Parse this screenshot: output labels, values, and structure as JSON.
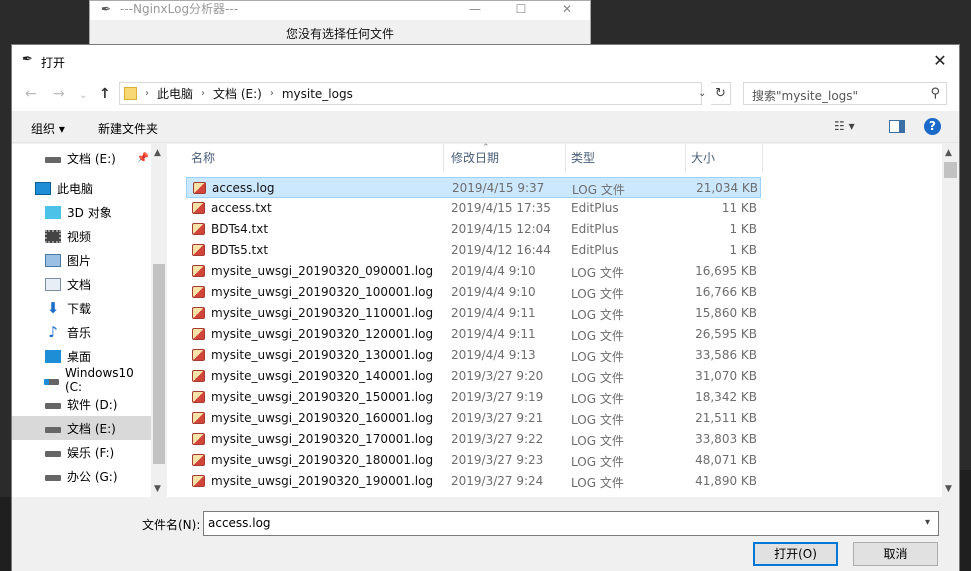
{
  "parent_window": {
    "title": "---NginxLog分析器---",
    "status": "您没有选择任何文件",
    "controls": [
      "—",
      "☐",
      "✕"
    ]
  },
  "dialog": {
    "title": "打开",
    "close": "✕"
  },
  "nav": {
    "back": "←",
    "forward": "→",
    "recent": "⌄",
    "up": "↑",
    "breadcrumb": [
      "此电脑",
      "文档 (E:)",
      "mysite_logs"
    ],
    "sep": "›",
    "dropdown": "⌄",
    "refresh": "↻",
    "search_placeholder": "搜索\"mysite_logs\"",
    "search_icon": "⚲"
  },
  "toolbar": {
    "organize": "组织 ▾",
    "new_folder": "新建文件夹",
    "view": "☷ ▾",
    "help": "?"
  },
  "sidebar": {
    "items": [
      {
        "label": "文档 (E:)",
        "icon": "drive-icon",
        "pinned": true
      },
      {
        "label": "此电脑",
        "icon": "computer-icon"
      },
      {
        "label": "3D 对象",
        "icon": "cube-icon"
      },
      {
        "label": "视频",
        "icon": "video-icon"
      },
      {
        "label": "图片",
        "icon": "picture-icon"
      },
      {
        "label": "文档",
        "icon": "document-icon"
      },
      {
        "label": "下载",
        "icon": "download-icon"
      },
      {
        "label": "音乐",
        "icon": "music-icon"
      },
      {
        "label": "桌面",
        "icon": "desktop-icon"
      },
      {
        "label": "Windows10 (C:",
        "icon": "os-drive-icon"
      },
      {
        "label": "软件 (D:)",
        "icon": "drive-icon"
      },
      {
        "label": "文档 (E:)",
        "icon": "drive-icon",
        "selected": true
      },
      {
        "label": "娱乐 (F:)",
        "icon": "drive-icon"
      },
      {
        "label": "办公 (G:)",
        "icon": "drive-icon"
      }
    ]
  },
  "columns": {
    "name": "名称",
    "date": "修改日期",
    "type": "类型",
    "size": "大小"
  },
  "files": [
    {
      "name": "access.log",
      "date": "2019/4/15 9:37",
      "type": "LOG 文件",
      "size": "21,034 KB",
      "selected": true
    },
    {
      "name": "access.txt",
      "date": "2019/4/15 17:35",
      "type": "EditPlus",
      "size": "11 KB"
    },
    {
      "name": "BDTs4.txt",
      "date": "2019/4/15 12:04",
      "type": "EditPlus",
      "size": "1 KB"
    },
    {
      "name": "BDTs5.txt",
      "date": "2019/4/12 16:44",
      "type": "EditPlus",
      "size": "1 KB"
    },
    {
      "name": "mysite_uwsgi_20190320_090001.log",
      "date": "2019/4/4 9:10",
      "type": "LOG 文件",
      "size": "16,695 KB"
    },
    {
      "name": "mysite_uwsgi_20190320_100001.log",
      "date": "2019/4/4 9:10",
      "type": "LOG 文件",
      "size": "16,766 KB"
    },
    {
      "name": "mysite_uwsgi_20190320_110001.log",
      "date": "2019/4/4 9:11",
      "type": "LOG 文件",
      "size": "15,860 KB"
    },
    {
      "name": "mysite_uwsgi_20190320_120001.log",
      "date": "2019/4/4 9:11",
      "type": "LOG 文件",
      "size": "26,595 KB"
    },
    {
      "name": "mysite_uwsgi_20190320_130001.log",
      "date": "2019/4/4 9:13",
      "type": "LOG 文件",
      "size": "33,586 KB"
    },
    {
      "name": "mysite_uwsgi_20190320_140001.log",
      "date": "2019/3/27 9:20",
      "type": "LOG 文件",
      "size": "31,070 KB"
    },
    {
      "name": "mysite_uwsgi_20190320_150001.log",
      "date": "2019/3/27 9:19",
      "type": "LOG 文件",
      "size": "18,342 KB"
    },
    {
      "name": "mysite_uwsgi_20190320_160001.log",
      "date": "2019/3/27 9:21",
      "type": "LOG 文件",
      "size": "21,511 KB"
    },
    {
      "name": "mysite_uwsgi_20190320_170001.log",
      "date": "2019/3/27 9:22",
      "type": "LOG 文件",
      "size": "33,803 KB"
    },
    {
      "name": "mysite_uwsgi_20190320_180001.log",
      "date": "2019/3/27 9:23",
      "type": "LOG 文件",
      "size": "48,071 KB"
    },
    {
      "name": "mysite_uwsgi_20190320_190001.log",
      "date": "2019/3/27 9:24",
      "type": "LOG 文件",
      "size": "41,890 KB"
    }
  ],
  "footer": {
    "filename_label": "文件名(N):",
    "filename_value": "access.log",
    "open_button": "打开(O)",
    "cancel_button": "取消"
  }
}
